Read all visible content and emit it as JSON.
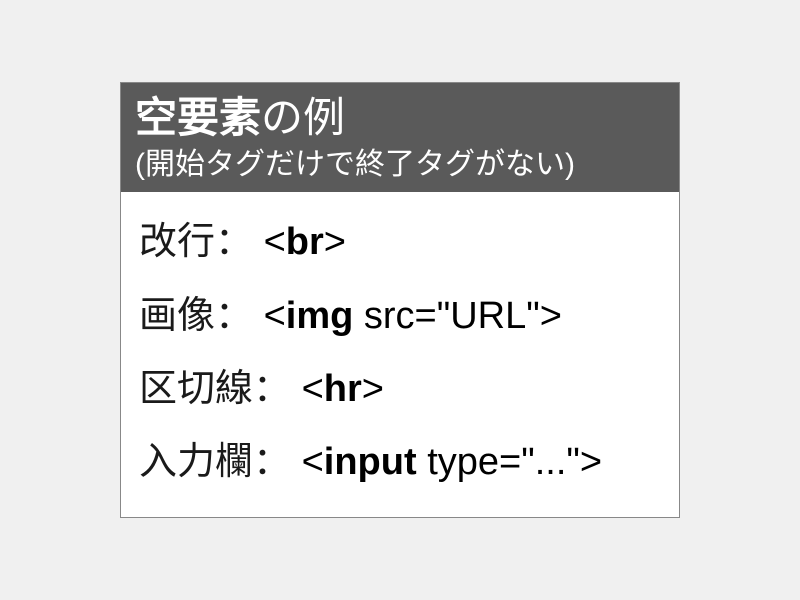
{
  "header": {
    "title_bold": "空要素",
    "title_light": "の例",
    "subtitle": "(開始タグだけで終了タグがない)"
  },
  "items": [
    {
      "label": "改行：",
      "open": "<",
      "name": "br",
      "attr": "",
      "close": ">"
    },
    {
      "label": "画像：",
      "open": "<",
      "name": "img",
      "attr": " src=\"URL\"",
      "close": ">"
    },
    {
      "label": "区切線：",
      "open": "<",
      "name": "hr",
      "attr": "",
      "close": ">"
    },
    {
      "label": "入力欄：",
      "open": "<",
      "name": "input",
      "attr": " type=\"...\"",
      "close": ">"
    }
  ]
}
